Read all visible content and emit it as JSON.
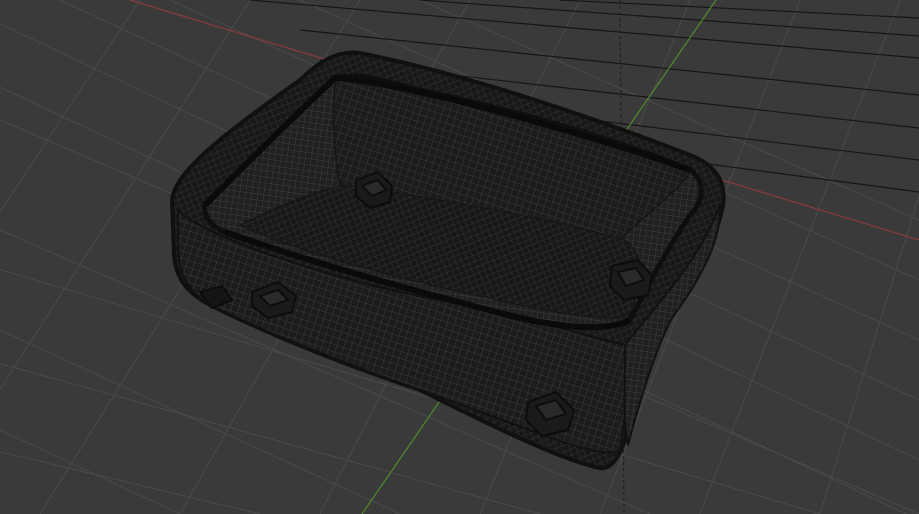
{
  "viewport": {
    "background": "#3a3a3a",
    "grid_color": "#4a4a4a",
    "axis_x_color": "#8c3b3b",
    "axis_y_color": "#4e8c2a",
    "mesh_color": "#1b1b1b",
    "mesh_wire_color": "#3f3f3f",
    "overlay_line_color": "#151515",
    "view_mode": "wireframe",
    "show_grid": true,
    "show_axes": true
  }
}
